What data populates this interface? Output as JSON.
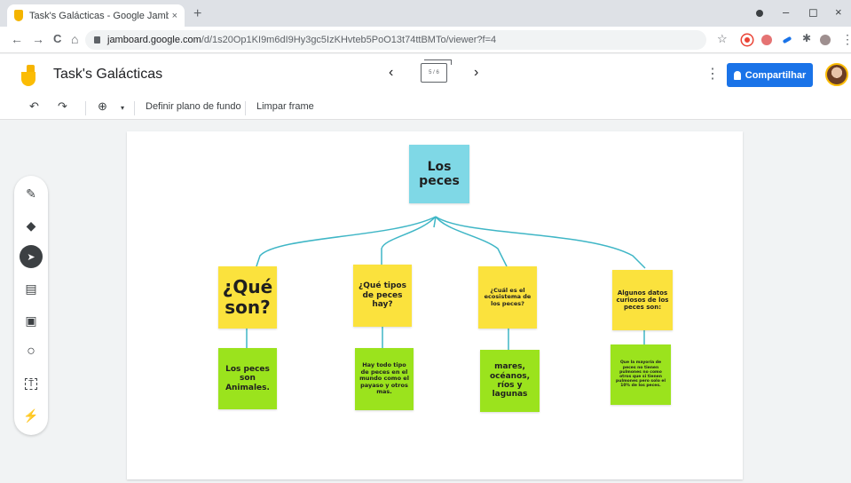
{
  "browser": {
    "tab_title": "Task's Galácticas - Google Jambo",
    "tab_close": "×",
    "new_tab": "+",
    "url_host": "jamboard.google.com",
    "url_path": "/d/1s20Op1KI9m6dI9Hy3gc5IzKHvteb5PoO13t74ttBMTo/viewer?f=4",
    "nav": {
      "back": "←",
      "forward": "→",
      "reload": "C",
      "home": "⌂"
    },
    "window": {
      "minimize": "–",
      "maximize": "◻",
      "close": "×"
    },
    "extension_colors": [
      "#3c4043",
      "#ea4335",
      "#e57373",
      "#1a73e8",
      "#5f6368",
      "#9e8f8f"
    ]
  },
  "app": {
    "title": "Task's Galácticas",
    "frame_indicator": "5 / 6",
    "prev": "‹",
    "next": "›",
    "more": "⋮",
    "share_label": "Compartilhar",
    "accent": "#1a73e8"
  },
  "toolbar": {
    "undo": "↶",
    "redo": "↷",
    "zoom": "⊕",
    "zoom_caret": "▾",
    "set_background": "Definir plano de fundo",
    "clear_frame": "Limpar frame"
  },
  "tools": [
    {
      "name": "pen-tool",
      "icon": "pen-icon",
      "glyph": "✎"
    },
    {
      "name": "eraser-tool",
      "icon": "eraser-icon",
      "glyph": "◆"
    },
    {
      "name": "select-tool",
      "icon": "cursor-icon",
      "glyph": "➤"
    },
    {
      "name": "sticky-note-tool",
      "icon": "sticky-note-icon",
      "glyph": "▤"
    },
    {
      "name": "image-tool",
      "icon": "image-icon",
      "glyph": "▣"
    },
    {
      "name": "shape-tool",
      "icon": "circle-icon",
      "glyph": "○"
    },
    {
      "name": "text-box-tool",
      "icon": "text-box-icon",
      "glyph": "T"
    },
    {
      "name": "laser-tool",
      "icon": "laser-icon",
      "glyph": "⚡"
    }
  ],
  "board": {
    "root": "Los peces",
    "questions": [
      "¿Qué son?",
      "¿Qué tipos de peces hay?",
      "¿Cuál es el ecosistema de los peces?",
      "Algunos datos curiosos de los peces son:"
    ],
    "answers": [
      "Los peces son Animales.",
      "Hay todo tipo de peces en el mundo como el payaso y otros mas.",
      "mares, océanos, ríos y lagunas",
      "Que la mayoría de peces no tienen pulmones no como otros que si tienen pulmones pero solo el 10% de los peces."
    ],
    "colors": {
      "root": "#7fd8e6",
      "question": "#fbe23d",
      "answer": "#9be31d",
      "line": "#3fb6c6"
    }
  }
}
